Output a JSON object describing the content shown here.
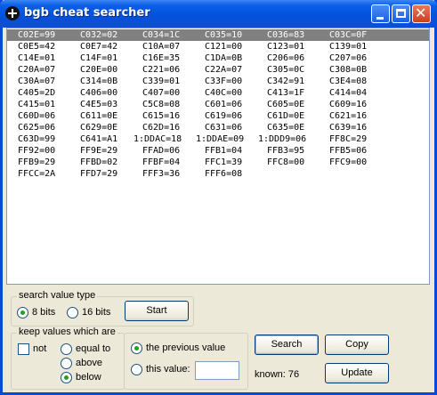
{
  "window": {
    "title": "bgb cheat searcher",
    "icon": "plus-cross-icon"
  },
  "list": {
    "selected_row": 0,
    "rows": [
      [
        "C02E=99",
        "C032=02",
        "C034=1C",
        "C035=10",
        "C036=83",
        "C03C=0F"
      ],
      [
        "C0E5=42",
        "C0E7=42",
        "C10A=07",
        "C121=00",
        "C123=01",
        "C139=01"
      ],
      [
        "C14E=01",
        "C14F=01",
        "C16E=35",
        "C1DA=0B",
        "C206=06",
        "C207=06"
      ],
      [
        "C20A=07",
        "C20E=00",
        "C221=06",
        "C22A=07",
        "C305=0C",
        "C308=0B"
      ],
      [
        "C30A=07",
        "C314=0B",
        "C339=01",
        "C33F=00",
        "C342=91",
        "C3E4=08"
      ],
      [
        "C405=2D",
        "C406=00",
        "C407=00",
        "C40C=00",
        "C413=1F",
        "C414=04"
      ],
      [
        "C415=01",
        "C4E5=03",
        "C5C8=08",
        "C601=06",
        "C605=0E",
        "C609=16"
      ],
      [
        "C60D=06",
        "C611=0E",
        "C615=16",
        "C619=06",
        "C61D=0E",
        "C621=16"
      ],
      [
        "C625=06",
        "C629=0E",
        "C62D=16",
        "C631=06",
        "C635=0E",
        "C639=16"
      ],
      [
        "C63D=99",
        "C641=A1",
        "1:DDAC=18",
        "1:DDAE=09",
        "1:DDD9=06",
        "FF8C=29"
      ],
      [
        "FF92=00",
        "FF9E=29",
        "FFAD=06",
        "FFB1=04",
        "FFB3=95",
        "FFB5=06"
      ],
      [
        "FFB9=29",
        "FFBD=02",
        "FFBF=04",
        "FFC1=39",
        "FFC8=00",
        "FFC9=00"
      ],
      [
        "FFCC=2A",
        "FFD7=29",
        "FFF3=36",
        "FFF6=08"
      ]
    ]
  },
  "search_type": {
    "label": "search value type",
    "option_8bits": "8 bits",
    "option_16bits": "16 bits",
    "selected": "8 bits",
    "start_button": "Start"
  },
  "keep_values": {
    "label": "keep values which are",
    "not_label": "not",
    "not_checked": false,
    "equal_to": "equal to",
    "above": "above",
    "below": "below",
    "selected_comparison": "below",
    "previous_value": "the previous value",
    "this_value": "this value:",
    "this_value_input": "",
    "selected_target": "the previous value"
  },
  "actions": {
    "search": "Search",
    "copy": "Copy",
    "update": "Update",
    "known": "known: 76"
  }
}
